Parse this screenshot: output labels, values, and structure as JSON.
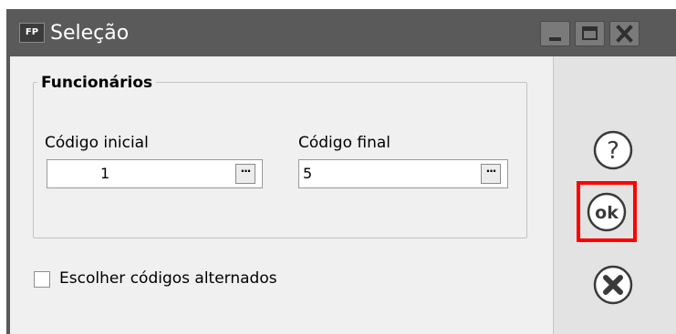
{
  "window": {
    "app_icon_text": "FP",
    "title": "Seleção",
    "controls": {
      "minimize": "minimize-icon",
      "maximize": "maximize-icon",
      "close": "close-icon"
    }
  },
  "group": {
    "title": "Funcionários",
    "fields": {
      "inicial": {
        "label": "Código inicial",
        "value": "1",
        "button_label": "···"
      },
      "final": {
        "label": "Código final",
        "value": "5",
        "button_label": "···"
      }
    }
  },
  "checkbox": {
    "label": "Escolher códigos alternados",
    "checked": false
  },
  "side_buttons": {
    "help": "question-circle-icon",
    "ok_label": "ok",
    "cancel": "x-circle-icon"
  },
  "colors": {
    "titlebar": "#5a5a5a",
    "highlight": "#ff0000"
  }
}
